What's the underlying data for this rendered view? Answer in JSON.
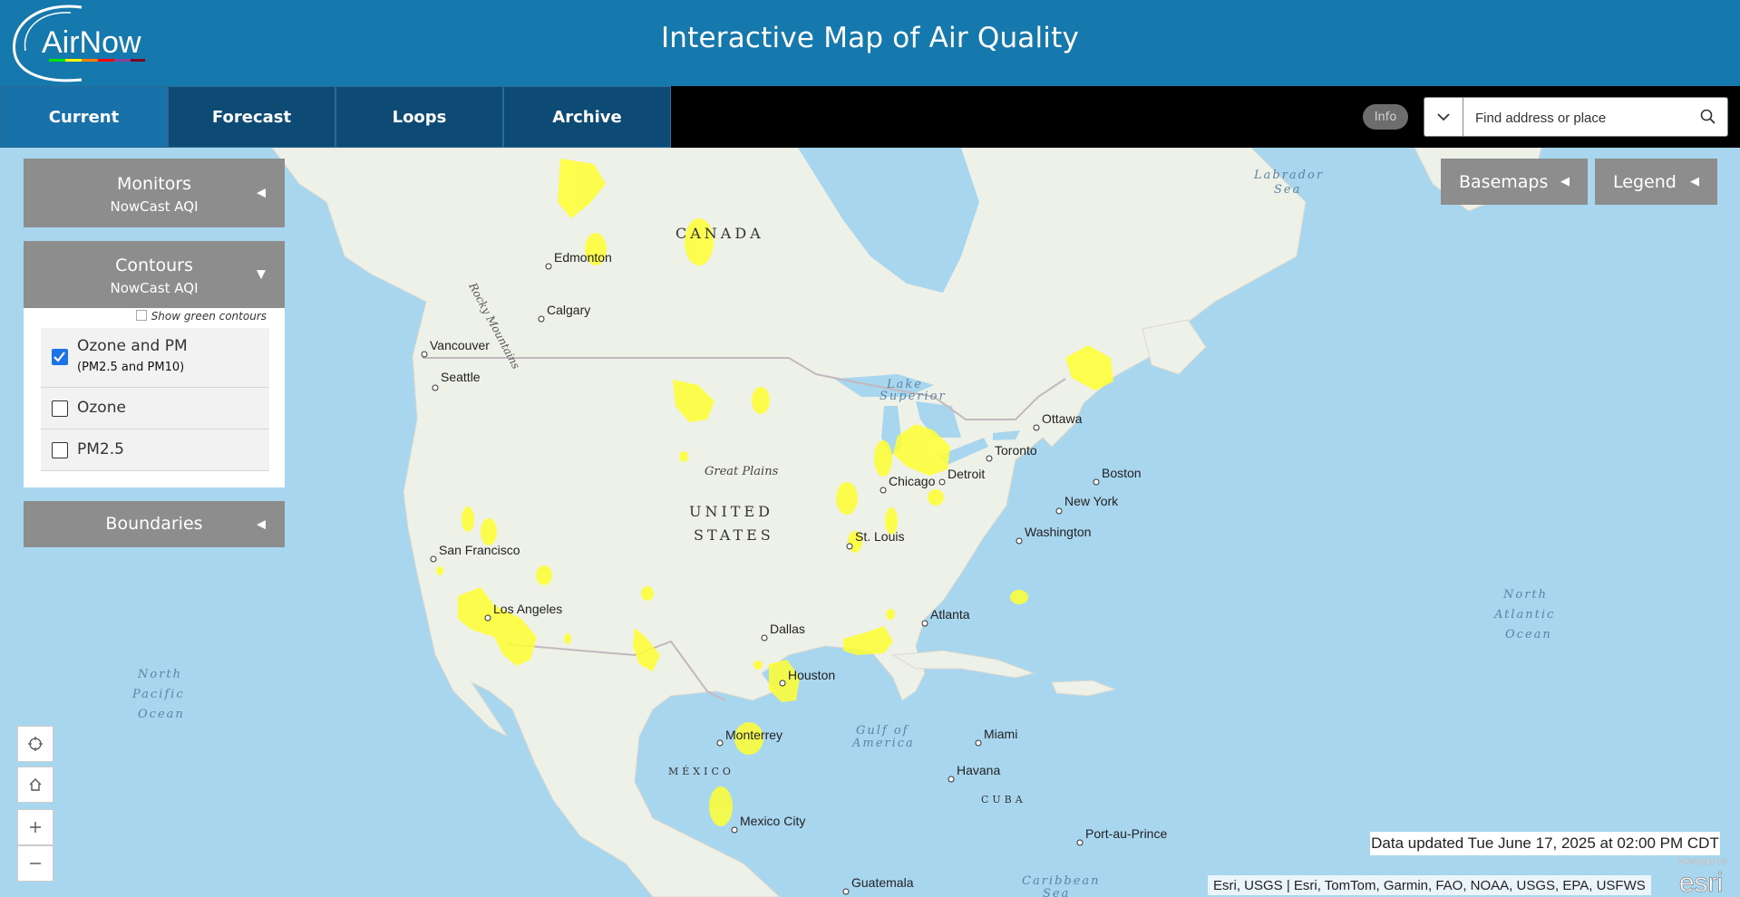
{
  "header": {
    "title": "Interactive Map of Air Quality",
    "logo_text": "AirNow"
  },
  "nav": {
    "tabs": [
      {
        "label": "Current",
        "active": true
      },
      {
        "label": "Forecast",
        "active": false
      },
      {
        "label": "Loops",
        "active": false
      },
      {
        "label": "Archive",
        "active": false
      }
    ],
    "info_label": "Info"
  },
  "search": {
    "placeholder": "Find address or place"
  },
  "panels": {
    "monitors": {
      "title": "Monitors",
      "subtitle": "NowCast AQI",
      "state": "collapsed"
    },
    "contours": {
      "title": "Contours",
      "subtitle": "NowCast AQI",
      "state": "expanded",
      "show_green_label": "Show green contours",
      "show_green_checked": false,
      "options": [
        {
          "label": "Ozone and PM",
          "sublabel": "(PM2.5 and PM10)",
          "checked": true
        },
        {
          "label": "Ozone",
          "sublabel": "",
          "checked": false
        },
        {
          "label": "PM2.5",
          "sublabel": "",
          "checked": false
        }
      ]
    },
    "boundaries": {
      "title": "Boundaries",
      "state": "collapsed"
    }
  },
  "map_buttons": {
    "basemaps": "Basemaps",
    "legend": "Legend"
  },
  "map": {
    "countries": {
      "canada": "CANADA",
      "us_line1": "UNITED",
      "us_line2": "STATES",
      "mexico": "MÉXICO",
      "cuba": "CUBA"
    },
    "regions": {
      "great_plains": "Great Plains",
      "rocky": "Rocky Mountains",
      "lake_superior_1": "Lake",
      "lake_superior_2": "Superior"
    },
    "water": {
      "labrador_1": "Labrador",
      "labrador_2": "Sea",
      "gulf_1": "Gulf of",
      "gulf_2": "America",
      "np_1": "North",
      "np_2": "Pacific",
      "np_3": "Ocean",
      "na_1": "North",
      "na_2": "Atlantic",
      "na_3": "Ocean",
      "caribbean_1": "Caribbean",
      "caribbean_2": "Sea"
    },
    "cities": {
      "edmonton": "Edmonton",
      "calgary": "Calgary",
      "vancouver": "Vancouver",
      "seattle": "Seattle",
      "san_francisco": "San Francisco",
      "los_angeles": "Los Angeles",
      "dallas": "Dallas",
      "houston": "Houston",
      "monterrey": "Monterrey",
      "mexico_city": "Mexico City",
      "guatemala": "Guatemala",
      "chicago": "Chicago",
      "st_louis": "St. Louis",
      "detroit": "Detroit",
      "toronto": "Toronto",
      "ottawa": "Ottawa",
      "boston": "Boston",
      "new_york": "New York",
      "washington": "Washington",
      "atlanta": "Atlanta",
      "miami": "Miami",
      "havana": "Havana",
      "port_au_prince": "Port-au-Prince"
    },
    "contour_color": "#ffff33",
    "land_color": "#eef1e8",
    "water_color": "#a9d6ef"
  },
  "status": {
    "updated": "Data updated Tue June 17, 2025 at 02:00 PM CDT",
    "attribution": "Esri, USGS | Esri, TomTom, Garmin, FAO, NOAA, USGS, EPA, USFWS",
    "esri_powered": "POWERED BY",
    "esri_logo": "esri"
  },
  "icons": {
    "locate": "crosshair-icon",
    "home": "home-icon",
    "zoom_in": "plus-icon",
    "zoom_out": "minus-icon",
    "search": "search-icon",
    "dropdown": "caret-down-icon"
  }
}
